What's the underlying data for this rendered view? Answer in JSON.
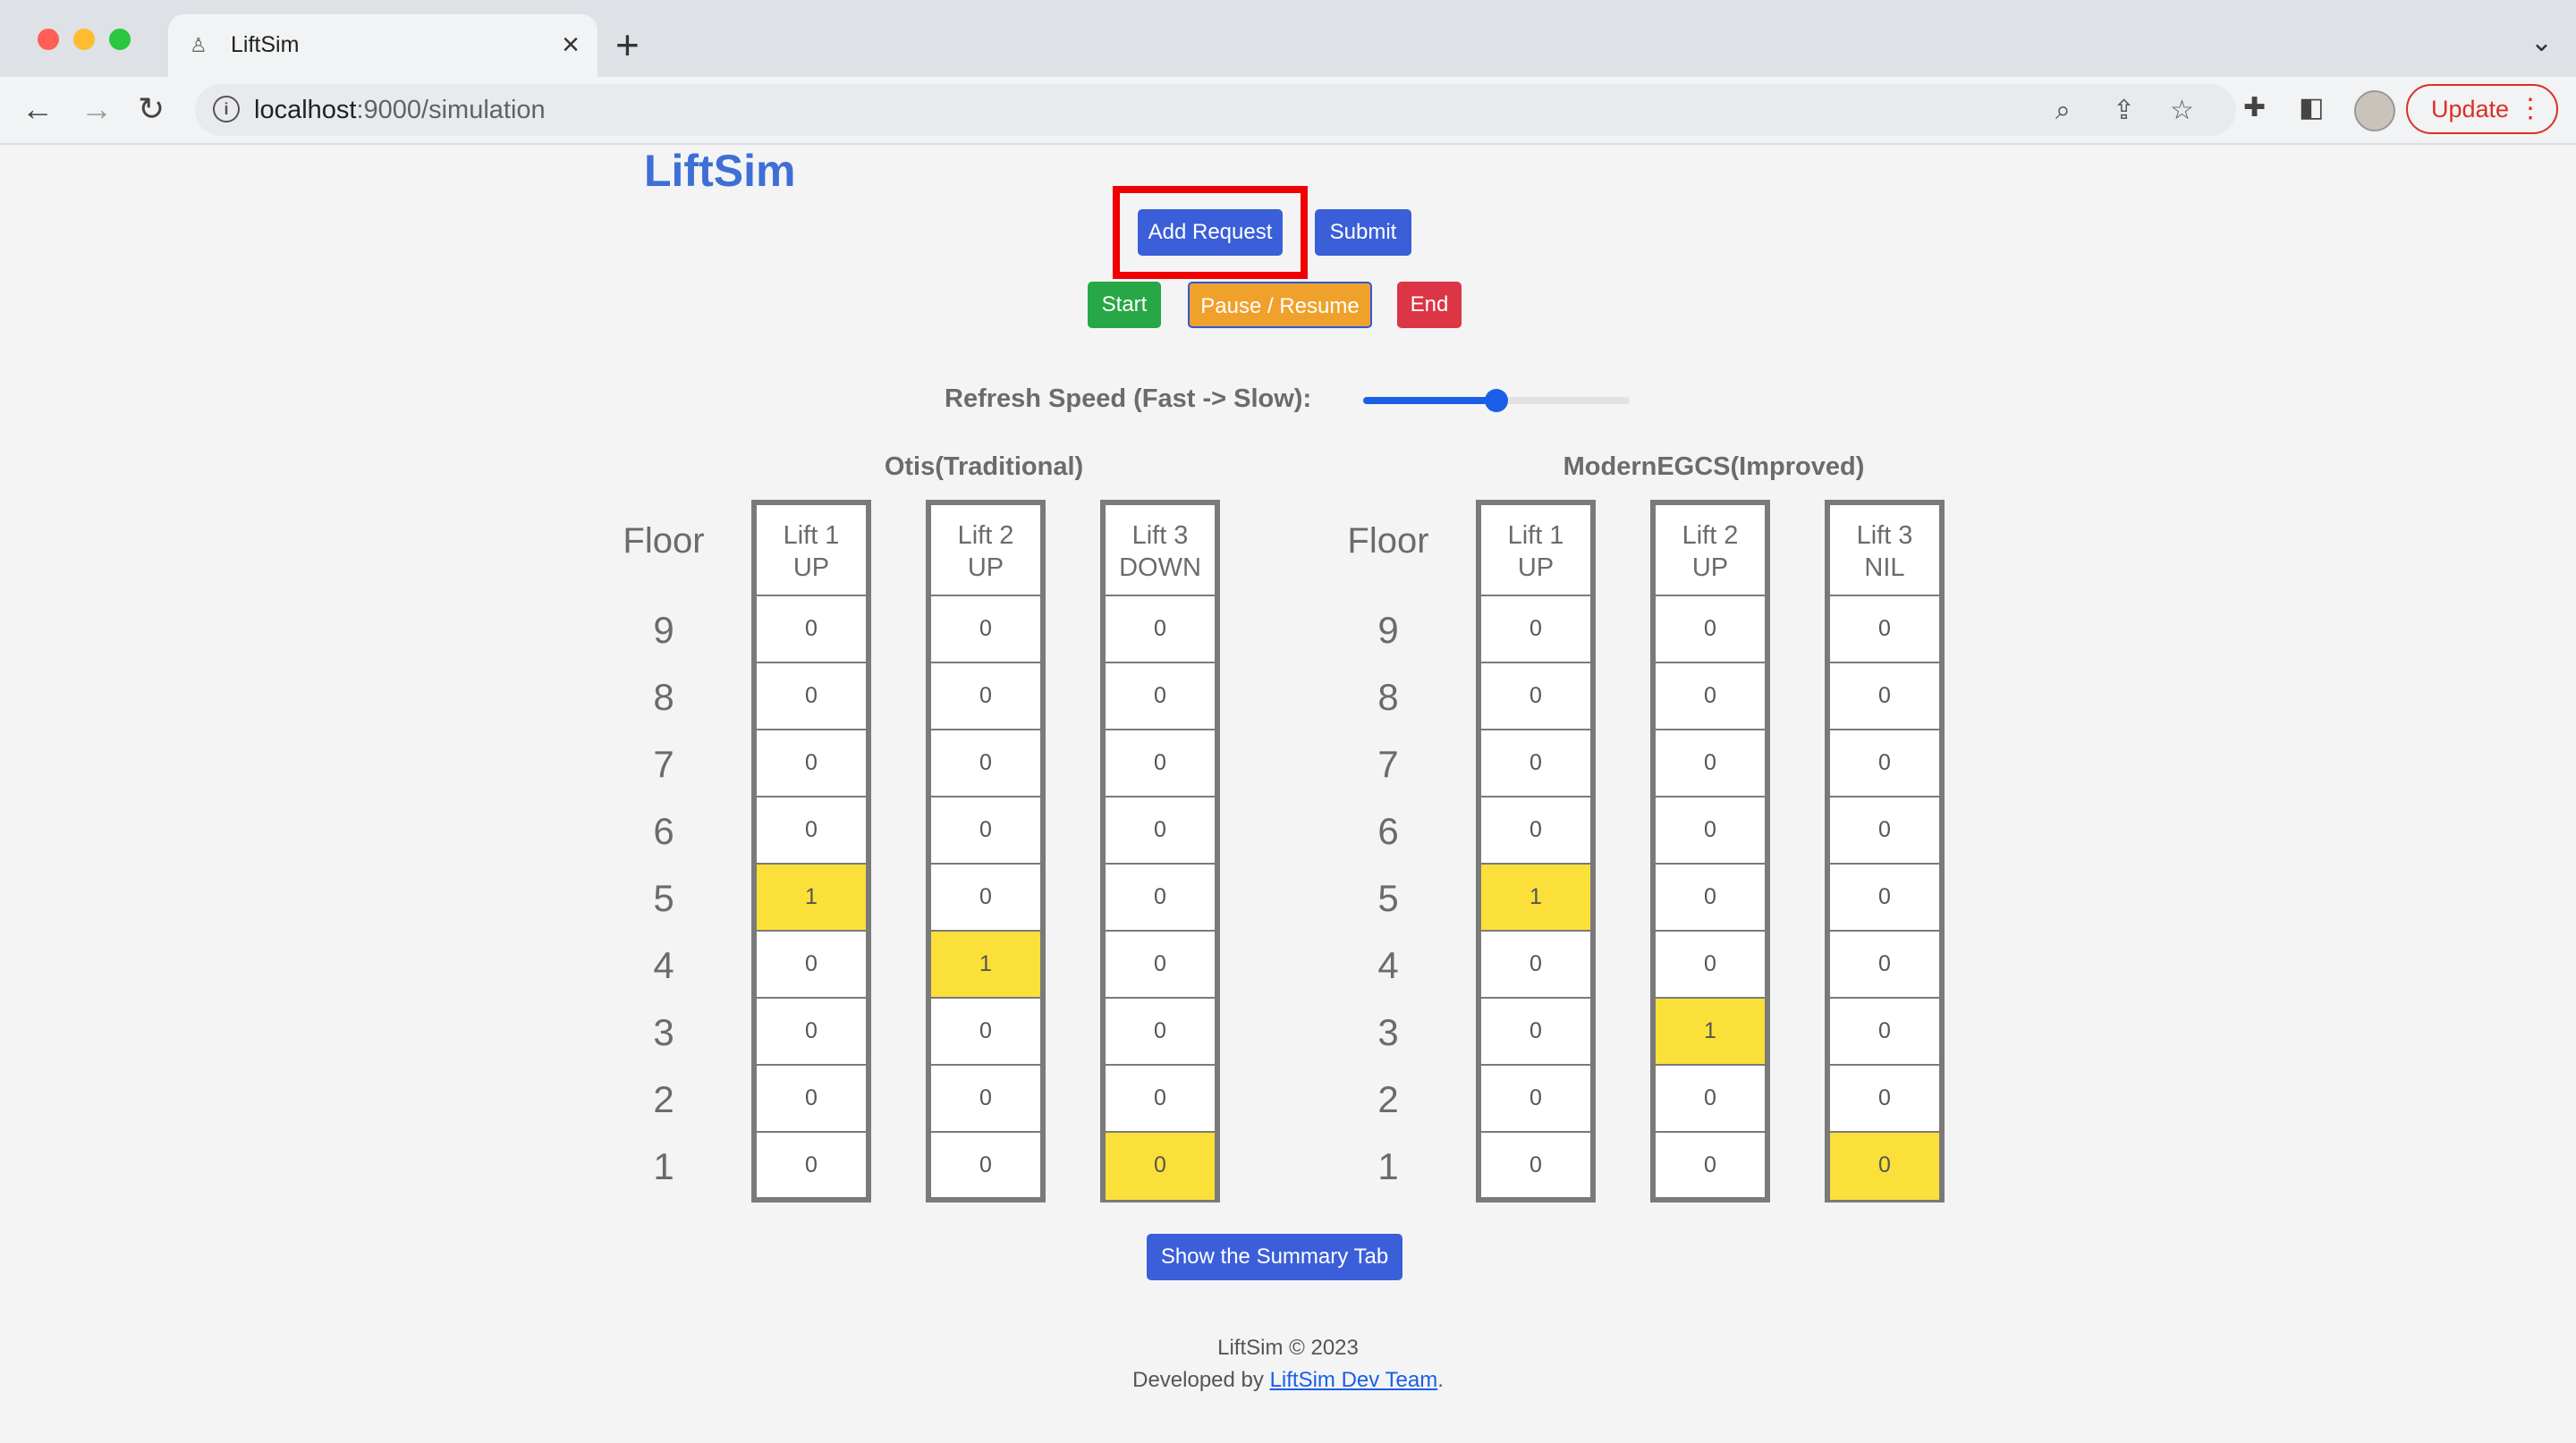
{
  "browser": {
    "tab_title": "LiftSim",
    "url_host": "localhost",
    "url_path": ":9000/simulation",
    "update_label": "Update"
  },
  "app": {
    "brand": "LiftSim",
    "buttons": {
      "add_request": "Add Request",
      "submit": "Submit",
      "start": "Start",
      "pause_resume": "Pause / Resume",
      "end": "End",
      "summary": "Show the Summary Tab"
    },
    "speed": {
      "label": "Refresh Speed (Fast -> Slow):",
      "value_fraction": 0.5
    },
    "colors": {
      "brand": "#3d6fd6",
      "active_cell": "#fbe03a",
      "highlight": "#f00000"
    },
    "floor_header": "Floor",
    "floors": [
      "9",
      "8",
      "7",
      "6",
      "5",
      "4",
      "3",
      "2",
      "1"
    ],
    "groups": [
      {
        "title": "Otis(Traditional)",
        "lifts": [
          {
            "line1": "Lift 1",
            "line2": "UP",
            "cells": [
              "0",
              "0",
              "0",
              "0",
              "1",
              "0",
              "0",
              "0",
              "0"
            ],
            "active_index": 4
          },
          {
            "line1": "Lift 2",
            "line2": "UP",
            "cells": [
              "0",
              "0",
              "0",
              "0",
              "0",
              "1",
              "0",
              "0",
              "0"
            ],
            "active_index": 5
          },
          {
            "line1": "Lift 3",
            "line2": "DOWN",
            "cells": [
              "0",
              "0",
              "0",
              "0",
              "0",
              "0",
              "0",
              "0",
              "0"
            ],
            "active_index": 8
          }
        ]
      },
      {
        "title": "ModernEGCS(Improved)",
        "lifts": [
          {
            "line1": "Lift 1",
            "line2": "UP",
            "cells": [
              "0",
              "0",
              "0",
              "0",
              "1",
              "0",
              "0",
              "0",
              "0"
            ],
            "active_index": 4
          },
          {
            "line1": "Lift 2",
            "line2": "UP",
            "cells": [
              "0",
              "0",
              "0",
              "0",
              "0",
              "0",
              "1",
              "0",
              "0"
            ],
            "active_index": 6
          },
          {
            "line1": "Lift 3",
            "line2": "NIL",
            "cells": [
              "0",
              "0",
              "0",
              "0",
              "0",
              "0",
              "0",
              "0",
              "0"
            ],
            "active_index": 8
          }
        ]
      }
    ],
    "footer": {
      "copyright": "LiftSim © 2023",
      "developed_by": "Developed by",
      "team_link": "LiftSim Dev Team",
      "period": "."
    }
  }
}
